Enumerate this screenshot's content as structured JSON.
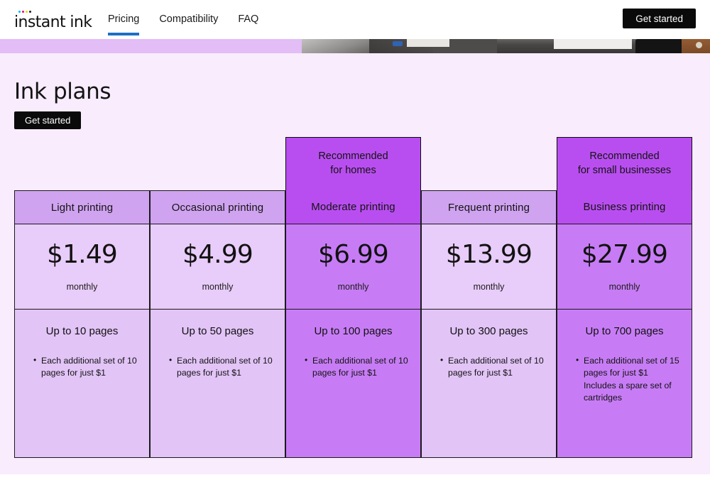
{
  "header": {
    "logo_text": "instant ink",
    "logo_dot_colors": [
      "#00B7E5",
      "#E6007E",
      "#F5D600",
      "#1A1A1A"
    ],
    "nav": [
      {
        "label": "Pricing",
        "active": true
      },
      {
        "label": "Compatibility",
        "active": false
      },
      {
        "label": "FAQ",
        "active": false
      }
    ],
    "cta_label": "Get started",
    "nav_active_underline_color": "#1E6FC4"
  },
  "hero": {
    "band_color": "#E2BDF6",
    "photo_alt": "printer-photo-strip"
  },
  "page": {
    "title": "Ink plans",
    "cta_label": "Get started",
    "background_color": "#F8ECFD"
  },
  "colors": {
    "highlight": "#B94EF0",
    "highlight_body": "#C77CF5",
    "header_normal": "#CFA3F0",
    "price_normal": "#E8CCF9",
    "feature_normal": "#E2C4F7",
    "border": "#1A1A1A"
  },
  "pricing": {
    "period_label": "monthly",
    "plans": [
      {
        "badge": "",
        "name": "Light printing",
        "price": "$1.49",
        "period": "monthly",
        "limit": "Up to 10 pages",
        "features": [
          "Each additional set of 10 pages for just $1"
        ],
        "highlighted": false
      },
      {
        "badge": "",
        "name": "Occasional printing",
        "price": "$4.99",
        "period": "monthly",
        "limit": "Up to 50 pages",
        "features": [
          "Each additional set of 10 pages for just $1"
        ],
        "highlighted": false
      },
      {
        "badge": "Recommended\nfor homes",
        "name": "Moderate printing",
        "price": "$6.99",
        "period": "monthly",
        "limit": "Up to 100 pages",
        "features": [
          "Each additional set of 10 pages for just $1"
        ],
        "highlighted": true
      },
      {
        "badge": "",
        "name": "Frequent printing",
        "price": "$13.99",
        "period": "monthly",
        "limit": "Up to 300 pages",
        "features": [
          "Each additional set of 10 pages for just $1"
        ],
        "highlighted": false
      },
      {
        "badge": "Recommended\nfor small businesses",
        "name": "Business printing",
        "price": "$27.99",
        "period": "monthly",
        "limit": "Up to 700 pages",
        "features": [
          "Each additional set of 15 pages for just $1 Includes a spare set of cartridges"
        ],
        "highlighted": true
      }
    ]
  }
}
